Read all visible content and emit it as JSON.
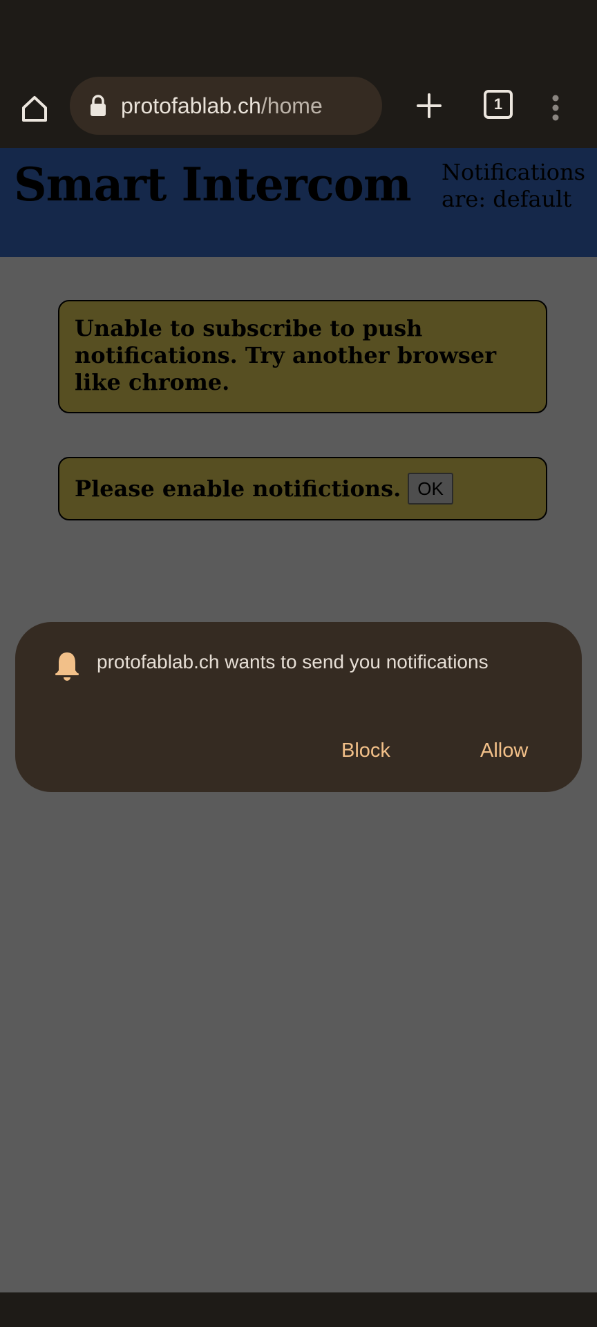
{
  "browser": {
    "url_domain": "protofablab.ch",
    "url_path": "/home",
    "tab_count": "1",
    "icons": {
      "home": "home-icon",
      "lock": "lock-icon",
      "new_tab": "plus-icon",
      "tabs": "tab-switcher-icon",
      "menu": "more-vert-icon"
    }
  },
  "page": {
    "title": "Smart Intercom",
    "notification_status": "Notifications are: default",
    "alerts": [
      {
        "text": "Unable to subscribe to push notifications. Try another browser like chrome."
      },
      {
        "text": "Please enable notifictions.",
        "button_label": "OK"
      }
    ],
    "colors": {
      "header_bg": "#15284a",
      "alert_bg": "#574f22"
    }
  },
  "permission_prompt": {
    "message": "protofablab.ch wants to send you notifications",
    "icon": "bell-icon",
    "block_label": "Block",
    "allow_label": "Allow",
    "accent_color": "#f2c089"
  }
}
